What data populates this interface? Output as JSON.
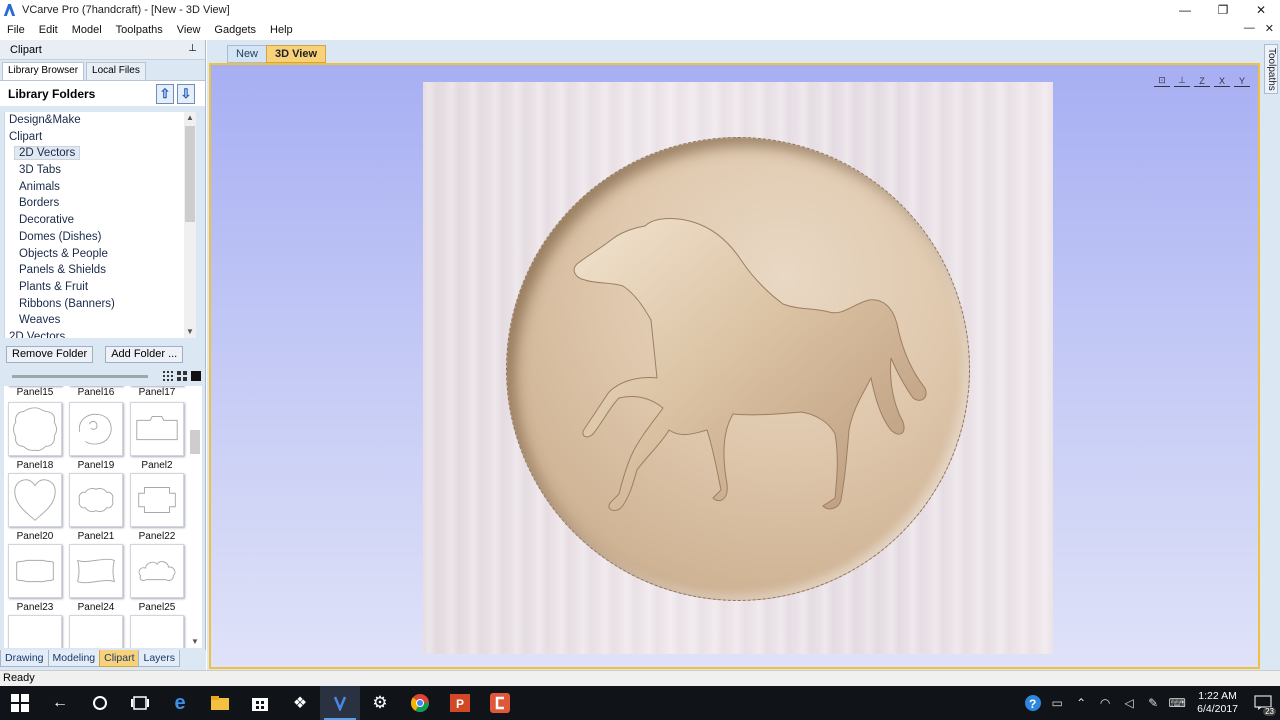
{
  "window": {
    "title": "VCarve Pro (7handcraft) - [New - 3D View]",
    "controls": {
      "minimize": "—",
      "maximize": "❐",
      "close": "✕"
    }
  },
  "menu": {
    "items": [
      "File",
      "Edit",
      "Model",
      "Toolpaths",
      "View",
      "Gadgets",
      "Help"
    ],
    "right_controls": {
      "minimize": "—",
      "close": "✕"
    }
  },
  "left_panel": {
    "header": "Clipart",
    "pin": "⊥",
    "tabs": [
      "Library Browser",
      "Local Files"
    ],
    "library_title": "Library Folders",
    "up_button": "⇧",
    "down_button": "⇩",
    "tree": [
      {
        "label": "Design&Make",
        "level": 0
      },
      {
        "label": "Clipart",
        "level": 0
      },
      {
        "label": "2D Vectors",
        "level": 1,
        "selected": true
      },
      {
        "label": "3D Tabs",
        "level": 1
      },
      {
        "label": "Animals",
        "level": 1
      },
      {
        "label": "Borders",
        "level": 1
      },
      {
        "label": "Decorative",
        "level": 1
      },
      {
        "label": "Domes (Dishes)",
        "level": 1
      },
      {
        "label": "Objects & People",
        "level": 1
      },
      {
        "label": "Panels & Shields",
        "level": 1
      },
      {
        "label": "Plants & Fruit",
        "level": 1
      },
      {
        "label": "Ribbons (Banners)",
        "level": 1
      },
      {
        "label": "Weaves",
        "level": 1
      },
      {
        "label": "2D Vectors",
        "level": 0
      }
    ],
    "remove_folder": "Remove Folder",
    "add_folder": "Add Folder ...",
    "thumbnail_labels_top": [
      "Panel15",
      "Panel16",
      "Panel17"
    ],
    "thumbnails": [
      {
        "row": [
          "Panel18",
          "Panel19",
          "Panel2"
        ],
        "shapes": [
          "wavy",
          "swirl",
          "notch"
        ]
      },
      {
        "row": [
          "Panel20",
          "Panel21",
          "Panel22"
        ],
        "shapes": [
          "heart",
          "cloud",
          "bracket"
        ]
      },
      {
        "row": [
          "Panel23",
          "Panel24",
          "Panel25"
        ],
        "shapes": [
          "scallop",
          "wave",
          "cloud2"
        ]
      }
    ],
    "bottom_tabs": [
      {
        "label": "Drawing",
        "active": false
      },
      {
        "label": "Modeling",
        "active": false
      },
      {
        "label": "Clipart",
        "active": true
      },
      {
        "label": "Layers",
        "active": false
      }
    ]
  },
  "main": {
    "tabs": [
      {
        "label": "New",
        "active": false
      },
      {
        "label": "3D View",
        "active": true
      }
    ],
    "view_icons": [
      "zoom-extents-icon",
      "iso-view-icon",
      "z-view-icon",
      "x-view-icon",
      "y-view-icon"
    ],
    "view_icon_labels": [
      "",
      "",
      "Z",
      "X",
      "Y"
    ]
  },
  "right_tab": "Toolpaths",
  "status": "Ready",
  "taskbar": {
    "apps": [
      "windows-start-icon",
      "back-icon",
      "cortana-icon",
      "task-view-icon",
      "edge-icon",
      "file-explorer-icon",
      "store-icon",
      "dropbox-icon",
      "vcarve-icon",
      "settings-icon",
      "chrome-icon",
      "powerpoint-icon",
      "app-icon"
    ],
    "time": "1:22 AM",
    "date": "6/4/2017",
    "notification_count": "23"
  },
  "colors": {
    "accent_tab": "#f7d27a",
    "panel_bg": "#dbe7f3",
    "viewport_top": "#a7aff3",
    "viewport_bottom": "#dfe2f8"
  }
}
